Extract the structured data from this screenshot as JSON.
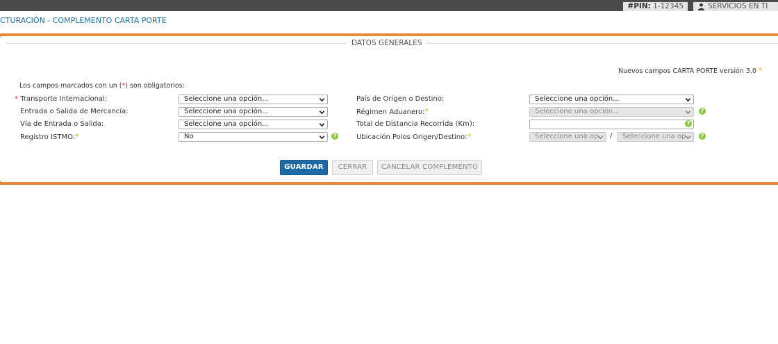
{
  "topbar": {
    "pin_label": "#PIN:",
    "pin_value": "1-12345",
    "services_label": "SERVICIOS EN TI"
  },
  "page_title": "CTURACIÓN - COMPLEMENTO CARTA PORTE",
  "section": {
    "legend": "DATOS GENERALES",
    "version_note": "Nuevos campos CARTA PORTE versión 3.0",
    "mandatory_note_prefix": "Los campos marcados con un (",
    "mandatory_note_star": "*",
    "mandatory_note_suffix": ") son obligatorios:"
  },
  "left_fields": [
    {
      "label": "Transporte Internacional:",
      "value": "Seleccione una opción..."
    },
    {
      "label": "Entrada o Salida de Mercancía:",
      "value": "Seleccione una opción..."
    },
    {
      "label": "Vía de Entrada o Salida:",
      "value": "Seleccione una opción..."
    },
    {
      "label": "Registro ISTMO:",
      "value": "No"
    }
  ],
  "right_fields": [
    {
      "label": "País de Origen o Destino:",
      "value": "Seleccione una opción..."
    },
    {
      "label": "Régimen Aduanero:",
      "value": "Seleccione una opción..."
    },
    {
      "label": "Total de Distancia Recorrida (Km):",
      "value": ""
    },
    {
      "label": "Ubicación Polos Origen/Destino:",
      "value_origin": "Seleccione una op",
      "value_destination": "Seleccione una op",
      "separator": "/"
    }
  ],
  "help_glyph": "?",
  "buttons": {
    "save": "GUARDAR",
    "close": "CERRAR",
    "cancel": "CANCELAR COMPLEMENTO"
  },
  "colors": {
    "accent_border": "#e8893c",
    "primary_button": "#1f6aa5",
    "title": "#1a6e9e",
    "help_icon": "#8dc63f",
    "optional_star": "#e5b100",
    "required_star": "#c0392b"
  },
  "icons": [
    "user-icon",
    "chevron-down-icon",
    "help-icon"
  ]
}
